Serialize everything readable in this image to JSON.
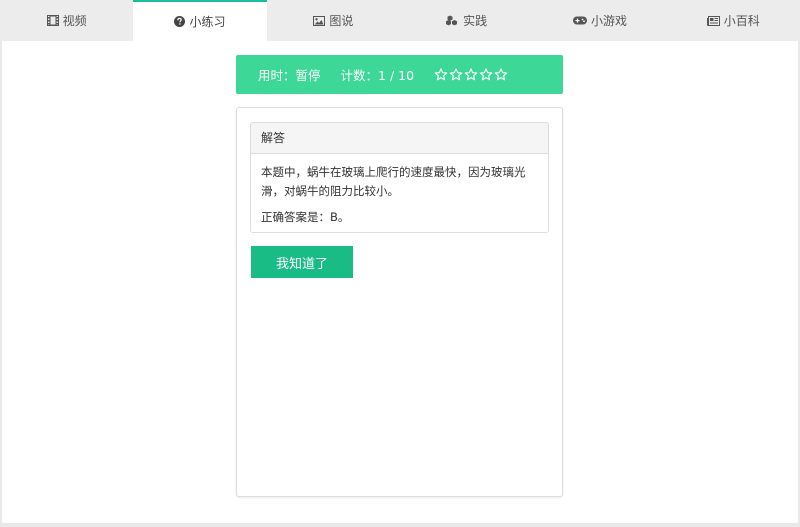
{
  "tabs": [
    {
      "label": "视频",
      "icon": "film-icon",
      "active": false
    },
    {
      "label": "小练习",
      "icon": "question-circle-icon",
      "active": true
    },
    {
      "label": "图说",
      "icon": "image-icon",
      "active": false
    },
    {
      "label": "实践",
      "icon": "cubes-icon",
      "active": false
    },
    {
      "label": "小游戏",
      "icon": "gamepad-icon",
      "active": false
    },
    {
      "label": "小百科",
      "icon": "newspaper-icon",
      "active": false
    }
  ],
  "status": {
    "time_text": "用时：暂停",
    "count_text": "计数：1 / 10",
    "rating_stars_total": 5,
    "rating_stars_filled": 0
  },
  "answer_panel": {
    "title": "解答",
    "explanation": "本题中，蜗牛在玻璃上爬行的速度最快，因为玻璃光滑，对蜗牛的阻力比较小。",
    "correct_answer": "正确答案是：B。"
  },
  "confirm_button": {
    "label": "我知道了"
  },
  "colors": {
    "accent": "#1abc9c",
    "status_bar": "#3dd897",
    "button": "#1abc86"
  }
}
